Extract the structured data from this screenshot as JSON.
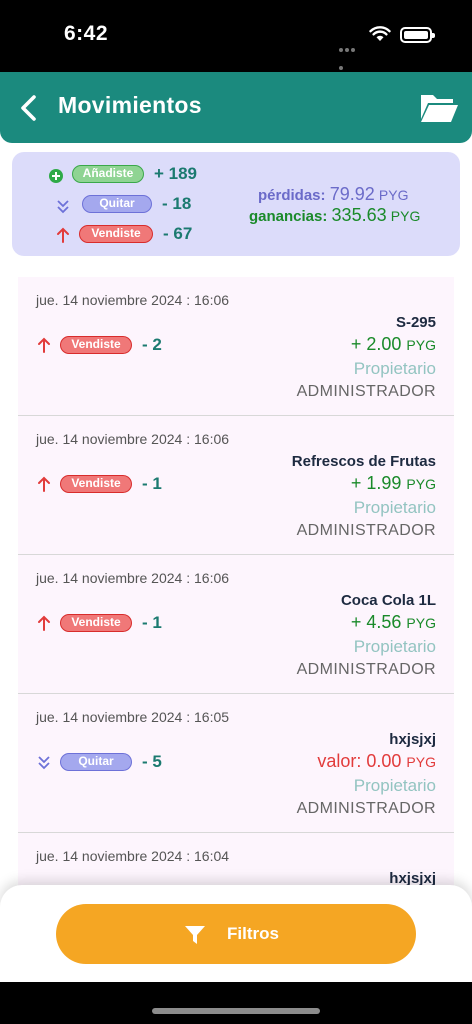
{
  "status_bar": {
    "time": "6:42"
  },
  "nav": {
    "title": "Movimientos"
  },
  "summary": {
    "added_label": "Añadiste",
    "added_count": "+ 189",
    "removed_label": "Quitar",
    "removed_count": "- 18",
    "sold_label": "Vendiste",
    "sold_count": "- 67",
    "losses_label": "pérdidas:",
    "losses_value": "79.92",
    "gains_label": "ganancias:",
    "gains_value": "335.63",
    "currency": "PYG"
  },
  "movements": [
    {
      "date": "jue. 14 noviembre 2024 : 16:06",
      "type": "Vendiste",
      "qty": "- 2",
      "product": "S-295",
      "amount": "+ 2.00",
      "currency": "PYG",
      "role": "Propietario",
      "user": "ADMINISTRADOR"
    },
    {
      "date": "jue. 14 noviembre 2024 : 16:06",
      "type": "Vendiste",
      "qty": "- 1",
      "product": "Refrescos de Frutas",
      "amount": "+ 1.99",
      "currency": "PYG",
      "role": "Propietario",
      "user": "ADMINISTRADOR"
    },
    {
      "date": "jue. 14 noviembre 2024 : 16:06",
      "type": "Vendiste",
      "qty": "- 1",
      "product": "Coca Cola 1L",
      "amount": "+ 4.56",
      "currency": "PYG",
      "role": "Propietario",
      "user": "ADMINISTRADOR"
    },
    {
      "date": "jue. 14 noviembre 2024 : 16:05",
      "type": "Quitar",
      "qty": "- 5",
      "product": "hxjsjxj",
      "amount_label": "valor:",
      "amount": "0.00",
      "currency": "PYG",
      "role": "Propietario",
      "user": "ADMINISTRADOR"
    },
    {
      "date": "jue. 14 noviembre 2024 : 16:04",
      "product": "hxjsjxj"
    }
  ],
  "filter": {
    "label": "Filtros"
  },
  "colors": {
    "header": "#1b8a7e",
    "summary_bg": "#dcdcfa",
    "filter_button": "#f5a623",
    "gain": "#1a8a2a",
    "loss": "#6b6bc9",
    "negative": "#e23b3b"
  }
}
